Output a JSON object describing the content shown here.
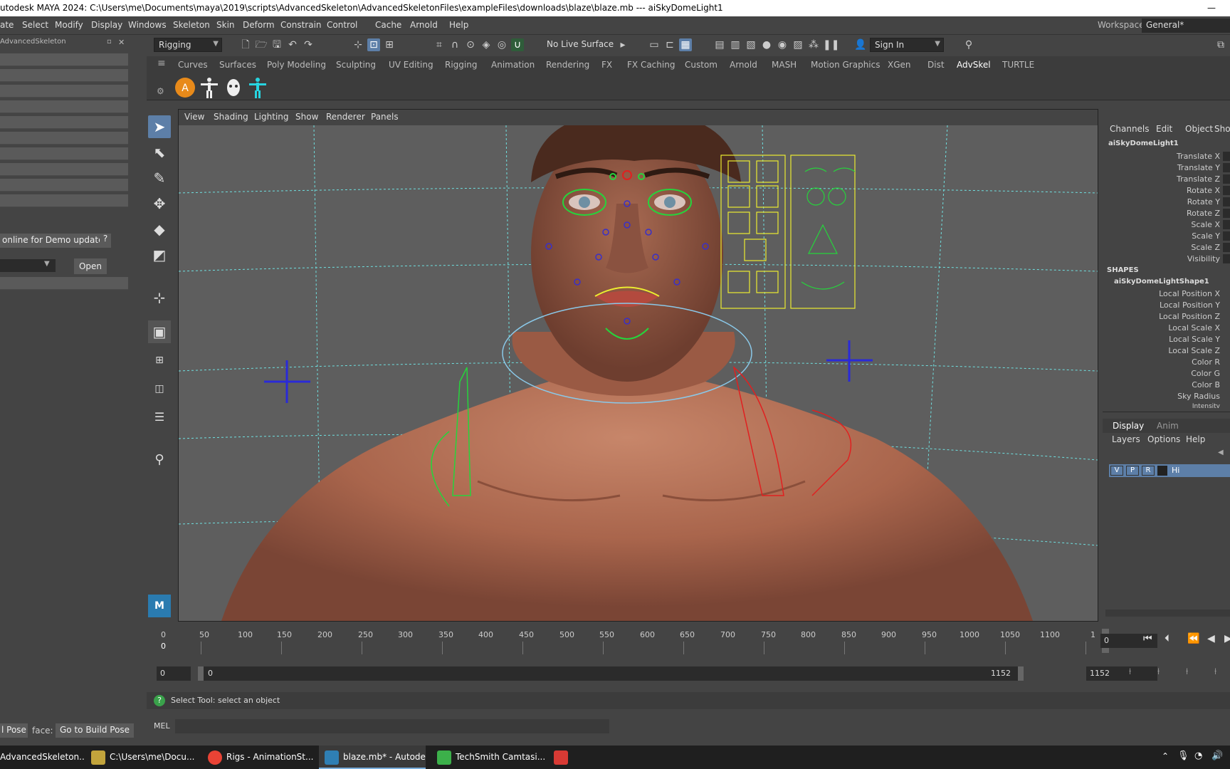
{
  "window": {
    "title": "utodesk MAYA 2024: C:\\Users\\me\\Documents\\maya\\2019\\scripts\\AdvancedSkeleton\\AdvancedSkeletonFiles\\exampleFiles\\downloads\\blaze\\blaze.mb   ---   aiSkyDomeLight1",
    "minimize": "—"
  },
  "menubar": {
    "items": [
      "ate",
      "Select",
      "Modify",
      "Display",
      "Windows",
      "Skeleton",
      "Skin",
      "Deform",
      "Constrain",
      "Control",
      "Cache",
      "Arnold",
      "Help"
    ],
    "workspace_label": "Workspace:",
    "workspace_value": "General*"
  },
  "toolbar": {
    "menuset": "Rigging",
    "live_surface": "No Live Surface",
    "sign_in": "Sign In"
  },
  "shelf": {
    "tabs": [
      "Curves",
      "Surfaces",
      "Poly Modeling",
      "Sculpting",
      "UV Editing",
      "Rigging",
      "Animation",
      "Rendering",
      "FX",
      "FX Caching",
      "Custom",
      "Arnold",
      "MASH",
      "Motion Graphics",
      "XGen",
      "Dist",
      "AdvSkel",
      "TURTLE"
    ],
    "active": "AdvSkel"
  },
  "left_panel": {
    "title": "AdvancedSkeleton",
    "demo_button": "online for Demo updates",
    "help": "?",
    "open_button": "Open",
    "pose_label": "l Pose",
    "face_label": "face:",
    "build_pose_button": "Go to Build Pose"
  },
  "viewport": {
    "menus": [
      "View",
      "Shading",
      "Lighting",
      "Show",
      "Renderer",
      "Panels"
    ]
  },
  "channel_box": {
    "tabs": [
      "Channels",
      "Edit",
      "Object",
      "Sho"
    ],
    "object_name": "aiSkyDomeLight1",
    "attributes": [
      "Translate X",
      "Translate Y",
      "Translate Z",
      "Rotate X",
      "Rotate Y",
      "Rotate Z",
      "Scale X",
      "Scale Y",
      "Scale Z",
      "Visibility"
    ],
    "shapes_header": "SHAPES",
    "shape_name": "aiSkyDomeLightShape1",
    "shape_attributes": [
      "Local Position X",
      "Local Position Y",
      "Local Position Z",
      "Local Scale X",
      "Local Scale Y",
      "Local Scale Z",
      "Color R",
      "Color G",
      "Color B",
      "Sky Radius",
      "Intensity"
    ]
  },
  "layer_editor": {
    "tabs": [
      "Display",
      "Anim"
    ],
    "menus": [
      "Layers",
      "Options",
      "Help"
    ],
    "layer_flags": [
      "V",
      "P",
      "R"
    ],
    "layer_name": "Hi"
  },
  "timeline": {
    "ticks": [
      "0",
      "50",
      "100",
      "150",
      "200",
      "250",
      "300",
      "350",
      "400",
      "450",
      "500",
      "550",
      "600",
      "650",
      "700",
      "750",
      "800",
      "850",
      "900",
      "950",
      "1000",
      "1050",
      "1100",
      "1"
    ],
    "current_frame_marker": "0",
    "current_frame": "0"
  },
  "range": {
    "start": "0",
    "slider_start": "0",
    "slider_end": "1152",
    "end": "1152"
  },
  "help_line": {
    "text": "Select Tool: select an object"
  },
  "command_line": {
    "label": "MEL"
  },
  "taskbar": {
    "items": [
      {
        "label": "AdvancedSkeleton...",
        "color": "#1f1f1f"
      },
      {
        "label": "C:\\Users\\me\\Docu...",
        "color": "#c2a43c"
      },
      {
        "label": "Rigs - AnimationSt...",
        "color": "#e94335"
      },
      {
        "label": "blaze.mb* - Autode...",
        "color": "#2f7fb4"
      },
      {
        "label": "TechSmith Camtasi...",
        "color": "#3cb04a"
      },
      {
        "label": "",
        "color": "#d83a34"
      }
    ]
  },
  "colors": {
    "accent": "#5d7fa8",
    "viewport_bg": "#5e5e5e",
    "grid": "#6fe0e0"
  }
}
